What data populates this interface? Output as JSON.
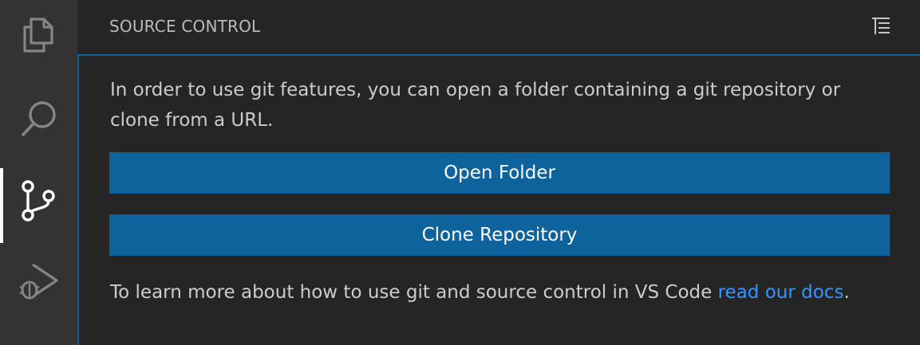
{
  "activity_bar": {
    "items": [
      {
        "name": "explorer",
        "icon": "files-icon",
        "active": false
      },
      {
        "name": "search",
        "icon": "search-icon",
        "active": false
      },
      {
        "name": "source-control",
        "icon": "source-control-icon",
        "active": true
      },
      {
        "name": "run-debug",
        "icon": "run-debug-icon",
        "active": false
      }
    ]
  },
  "sidebar": {
    "title": "SOURCE CONTROL",
    "header_action_icon": "view-as-tree-icon"
  },
  "welcome": {
    "message": "In order to use git features, you can open a folder containing a git repository or clone from a URL.",
    "open_folder_label": "Open Folder",
    "clone_repository_label": "Clone Repository",
    "learn_prefix": "To learn more about how to use git and source control in VS Code ",
    "docs_link_label": "read our docs",
    "learn_suffix": "."
  },
  "colors": {
    "activity_bar_bg": "#333333",
    "sidebar_bg": "#252526",
    "button_bg": "#0e639c",
    "focus_border": "#0e639c",
    "link": "#3794ff",
    "text": "#cccccc",
    "icon_inactive": "#858585",
    "icon_active": "#ffffff"
  }
}
